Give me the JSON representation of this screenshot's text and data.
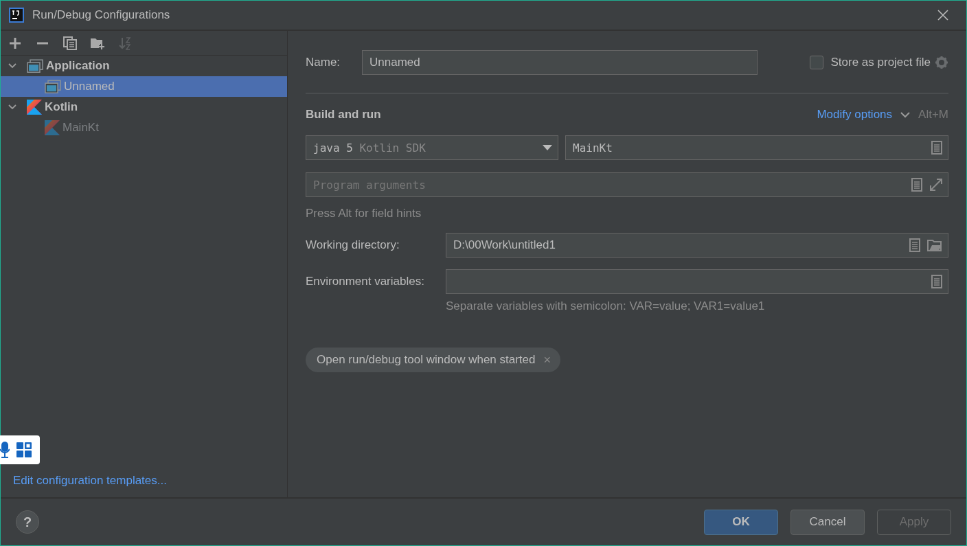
{
  "window": {
    "title": "Run/Debug Configurations"
  },
  "toolbar": [
    {
      "kind": "add",
      "disabled": false
    },
    {
      "kind": "remove",
      "disabled": false
    },
    {
      "kind": "copy",
      "disabled": false
    },
    {
      "kind": "folder",
      "disabled": false
    },
    {
      "kind": "sort",
      "disabled": true
    }
  ],
  "tree": [
    {
      "label": "Application",
      "kind": "application",
      "expanded": true,
      "selected": false,
      "temporary": false,
      "children": [
        {
          "label": "Unnamed",
          "kind": "application",
          "selected": true,
          "temporary": false
        }
      ]
    },
    {
      "label": "Kotlin",
      "kind": "kotlin",
      "expanded": true,
      "selected": false,
      "temporary": false,
      "children": [
        {
          "label": "MainKt",
          "kind": "kotlin",
          "selected": false,
          "temporary": true
        }
      ]
    }
  ],
  "edit_templates_link": "Edit configuration templates...",
  "name": {
    "label": "Name:",
    "value": "Unnamed"
  },
  "store_as_project_file": {
    "label": "Store as project file",
    "checked": false
  },
  "section": {
    "title": "Build and run",
    "modify_options": "Modify options",
    "shortcut": "Alt+M"
  },
  "sdk": {
    "value": "java 5",
    "detail": "Kotlin SDK"
  },
  "main_class": {
    "value": "MainKt"
  },
  "program_arguments": {
    "placeholder": "Program arguments"
  },
  "field_hint": "Press Alt for field hints",
  "working_directory": {
    "label": "Working directory:",
    "value": "D:\\00Work\\untitled1"
  },
  "environment_variables": {
    "label": "Environment variables:",
    "hint": "Separate variables with semicolon: VAR=value; VAR1=value1"
  },
  "options": [
    {
      "label": "Open run/debug tool window when started",
      "close": "×"
    }
  ],
  "buttons": [
    {
      "label": "OK",
      "kind": "default",
      "disabled": false
    },
    {
      "label": "Cancel",
      "kind": "normal",
      "disabled": false
    },
    {
      "label": "Apply",
      "kind": "normal",
      "disabled": true
    }
  ],
  "help": "?"
}
